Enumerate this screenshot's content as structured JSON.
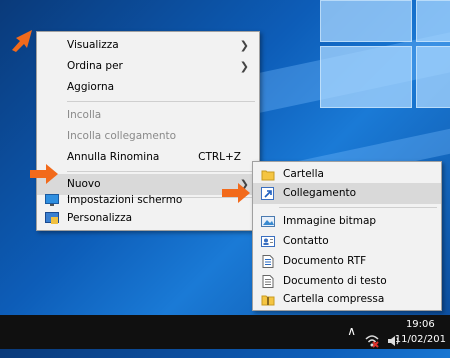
{
  "context_menu": {
    "items": [
      {
        "label": "Visualizza",
        "submenu": true
      },
      {
        "label": "Ordina per",
        "submenu": true
      },
      {
        "label": "Aggiorna"
      },
      {
        "label": "Incolla",
        "disabled": true
      },
      {
        "label": "Incolla collegamento",
        "disabled": true
      },
      {
        "label": "Annulla Rinomina",
        "shortcut": "CTRL+Z"
      },
      {
        "label": "Nuovo",
        "submenu": true,
        "highlighted": true
      },
      {
        "label": "Impostazioni schermo",
        "icon": "display-icon"
      },
      {
        "label": "Personalizza",
        "icon": "personalize-icon"
      }
    ]
  },
  "submenu_new": {
    "items": [
      {
        "label": "Cartella",
        "icon": "folder-icon"
      },
      {
        "label": "Collegamento",
        "icon": "shortcut-icon",
        "highlighted": true
      },
      {
        "label": "Immagine bitmap",
        "icon": "bitmap-icon"
      },
      {
        "label": "Contatto",
        "icon": "contact-icon"
      },
      {
        "label": "Documento RTF",
        "icon": "rtf-document-icon"
      },
      {
        "label": "Documento di testo",
        "icon": "text-document-icon"
      },
      {
        "label": "Cartella compressa",
        "icon": "zip-folder-icon"
      }
    ]
  },
  "taskbar": {
    "time": "19:06",
    "date": "11/02/201"
  },
  "colors": {
    "annotation_arrow": "#f26a1b",
    "highlight": "#d9d9d9",
    "menu_bg": "#f2f2f2"
  }
}
